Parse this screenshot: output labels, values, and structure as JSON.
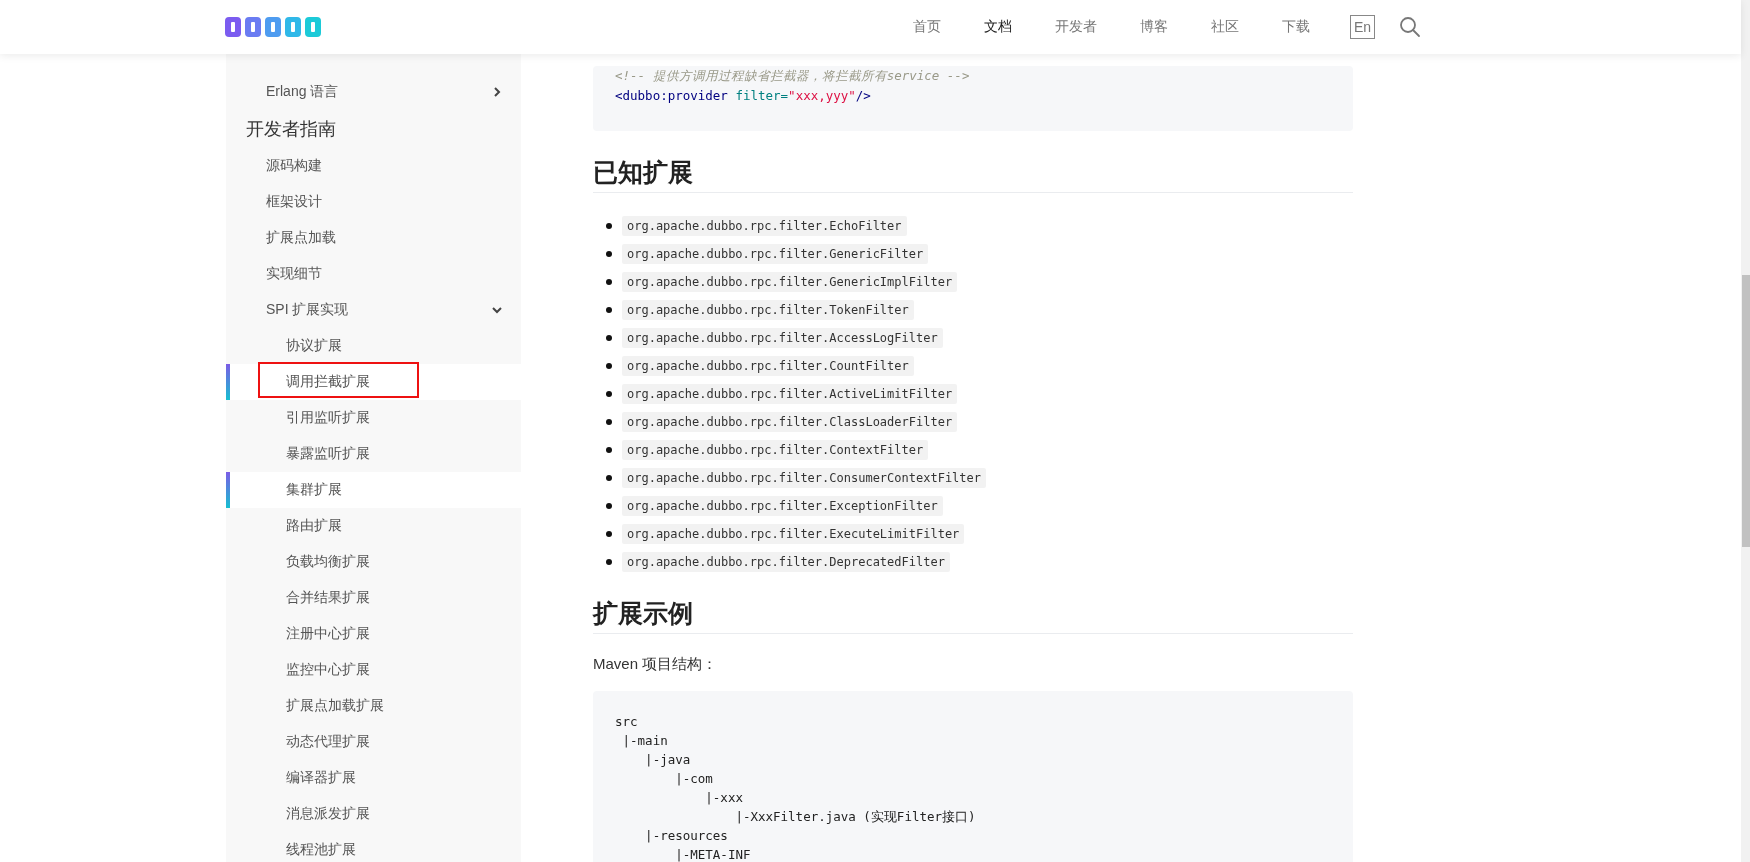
{
  "header": {
    "nav": [
      {
        "label": "首页",
        "selected": false
      },
      {
        "label": "文档",
        "selected": true
      },
      {
        "label": "开发者",
        "selected": false
      },
      {
        "label": "博客",
        "selected": false
      },
      {
        "label": "社区",
        "selected": false
      },
      {
        "label": "下载",
        "selected": false
      }
    ],
    "language": "En"
  },
  "sidebar": {
    "items": [
      {
        "label": "Erlang 语言",
        "kind": "item",
        "expanded": false,
        "selected": false
      },
      {
        "label": "开发者指南",
        "kind": "section"
      },
      {
        "label": "源码构建",
        "kind": "item",
        "selected": false
      },
      {
        "label": "框架设计",
        "kind": "item",
        "selected": false
      },
      {
        "label": "扩展点加载",
        "kind": "item",
        "selected": false
      },
      {
        "label": "实现细节",
        "kind": "item",
        "selected": false
      },
      {
        "label": "SPI 扩展实现",
        "kind": "item",
        "expanded": true,
        "selected": false,
        "children": [
          {
            "label": "协议扩展",
            "selected": false,
            "annotated": false
          },
          {
            "label": "调用拦截扩展",
            "selected": true,
            "annotated": true
          },
          {
            "label": "引用监听扩展",
            "selected": false,
            "annotated": false
          },
          {
            "label": "暴露监听扩展",
            "selected": false,
            "annotated": false
          },
          {
            "label": "集群扩展",
            "selected": true,
            "annotated": false
          },
          {
            "label": "路由扩展",
            "selected": false,
            "annotated": false
          },
          {
            "label": "负载均衡扩展",
            "selected": false,
            "annotated": false
          },
          {
            "label": "合并结果扩展",
            "selected": false,
            "annotated": false
          },
          {
            "label": "注册中心扩展",
            "selected": false,
            "annotated": false
          },
          {
            "label": "监控中心扩展",
            "selected": false,
            "annotated": false
          },
          {
            "label": "扩展点加载扩展",
            "selected": false,
            "annotated": false
          },
          {
            "label": "动态代理扩展",
            "selected": false,
            "annotated": false
          },
          {
            "label": "编译器扩展",
            "selected": false,
            "annotated": false
          },
          {
            "label": "消息派发扩展",
            "selected": false,
            "annotated": false
          },
          {
            "label": "线程池扩展",
            "selected": false,
            "annotated": false
          }
        ]
      }
    ]
  },
  "content": {
    "code_top": [
      [
        {
          "text": "<!-- 提供方调用过程缺省拦截器，将拦截所有service -->",
          "kind": "comment"
        }
      ],
      [
        {
          "text": "<dubbo:provider ",
          "kind": "tag"
        },
        {
          "text": "filter=",
          "kind": "attr"
        },
        {
          "text": "\"xxx,yyy\"",
          "kind": "string"
        },
        {
          "text": "/>",
          "kind": "tag"
        }
      ]
    ],
    "heading_1": "已知扩展",
    "filters": [
      "org.apache.dubbo.rpc.filter.EchoFilter",
      "org.apache.dubbo.rpc.filter.GenericFilter",
      "org.apache.dubbo.rpc.filter.GenericImplFilter",
      "org.apache.dubbo.rpc.filter.TokenFilter",
      "org.apache.dubbo.rpc.filter.AccessLogFilter",
      "org.apache.dubbo.rpc.filter.CountFilter",
      "org.apache.dubbo.rpc.filter.ActiveLimitFilter",
      "org.apache.dubbo.rpc.filter.ClassLoaderFilter",
      "org.apache.dubbo.rpc.filter.ContextFilter",
      "org.apache.dubbo.rpc.filter.ConsumerContextFilter",
      "org.apache.dubbo.rpc.filter.ExceptionFilter",
      "org.apache.dubbo.rpc.filter.ExecuteLimitFilter",
      "org.apache.dubbo.rpc.filter.DeprecatedFilter"
    ],
    "heading_2": "扩展示例",
    "paragraph": "Maven 项目结构：",
    "code_tree": [
      "src",
      " |-main",
      "    |-java",
      "        |-com",
      "            |-xxx",
      "                |-XxxFilter.java (实现Filter接口)",
      "    |-resources",
      "        |-META-INF"
    ]
  }
}
